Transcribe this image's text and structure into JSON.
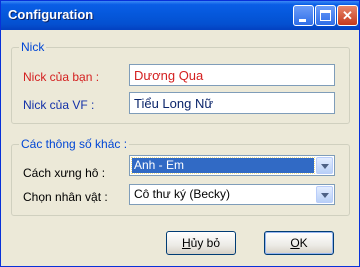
{
  "window": {
    "title": "Configuration"
  },
  "nick_group": {
    "legend": "Nick",
    "your_nick_label": "Nick của bạn :",
    "your_nick_value": "Dương Qua",
    "vf_nick_label": "Nick của VF :",
    "vf_nick_value": "Tiểu Long Nữ"
  },
  "other_group": {
    "legend": "Các thông số khác :",
    "address_label": "Cách xưng hô :",
    "address_value": "Anh - Em",
    "character_label": "Chọn nhân vật :",
    "character_value": "Cô thư ký (Becky)"
  },
  "buttons": {
    "cancel_prefix": "H",
    "cancel_rest": "ủy bỏ",
    "ok_prefix": "O",
    "ok_rest": "K"
  },
  "colors": {
    "title_bar": "#0558dc",
    "legend_text": "#0046d5",
    "your_nick_text": "#d41f1f",
    "vf_nick_text": "#1230a8"
  },
  "icons": [
    "minimize-icon",
    "maximize-icon",
    "close-icon",
    "chevron-down-icon"
  ]
}
